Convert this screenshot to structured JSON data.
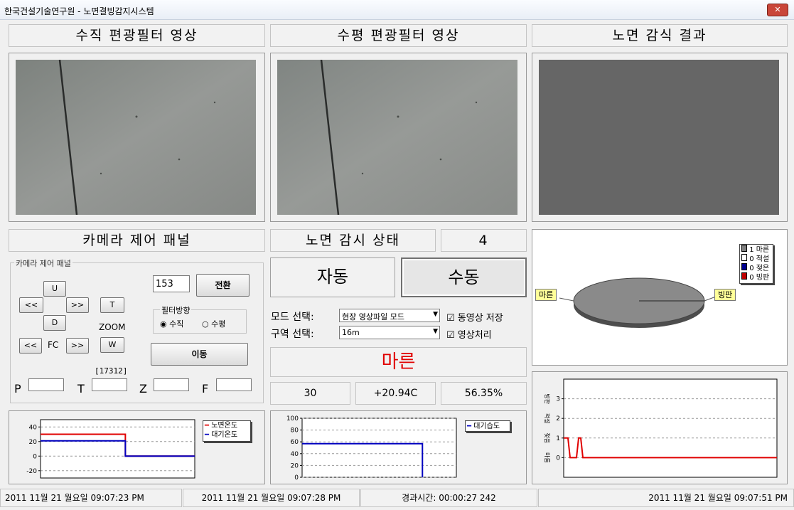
{
  "window": {
    "title": "한국건설기술연구원 - 노면결빙감지시스템",
    "close_label": "✕"
  },
  "panels": {
    "vertical_title": "수직 편광필터 영상",
    "horizontal_title": "수평 편광필터 영상",
    "result_title": "노면 감식 결과"
  },
  "camera": {
    "title": "카메라 제어 패널",
    "group_label": "카메라 제어 패널",
    "btn_up": "U",
    "btn_down": "D",
    "btn_left": "<<",
    "btn_right": ">>",
    "btn_t": "T",
    "btn_w": "W",
    "zoom_label": "ZOOM",
    "btn_fc_left": "<<",
    "fc_label": "FC",
    "btn_fc_right": ">>",
    "preset_value": "153",
    "switch_label": "전환",
    "filter_group": "필터방향",
    "radio_vertical": "수직",
    "radio_horizontal": "수평",
    "move_label": "이동",
    "counter": "[17312]",
    "p_label": "P",
    "t_label": "T",
    "z_label": "Z",
    "f_label": "F",
    "p_value": "",
    "t_value": "",
    "z_value": "",
    "f_value": ""
  },
  "monitor": {
    "title": "노면 감시 상태",
    "count": "4",
    "auto_label": "자동",
    "manual_label": "수동",
    "mode_label": "모드 선택:",
    "mode_value": "현장 영상파일 모드",
    "zone_label": "구역 선택:",
    "zone_value": "16m",
    "save_video_label": "동영상 저장",
    "image_proc_label": "영상처리",
    "state_text": "마른",
    "count2": "30",
    "temperature": "+20.94C",
    "humidity": "56.35%"
  },
  "pie": {
    "legend": [
      {
        "label": "1 마른",
        "color": "#808080"
      },
      {
        "label": "0 적설",
        "color": "#ffffff"
      },
      {
        "label": "0 젖은",
        "color": "#000090"
      },
      {
        "label": "0 빙판",
        "color": "#c00000"
      }
    ],
    "left_tag": "마른",
    "right_tag": "빙판",
    "slices": [
      {
        "label": "마른",
        "value": 1
      },
      {
        "label": "적설",
        "value": 0
      },
      {
        "label": "젖은",
        "value": 0
      },
      {
        "label": "빙판",
        "value": 0
      }
    ]
  },
  "charts": {
    "temp_legend_surface": "노면온도",
    "temp_legend_air": "대기온도",
    "hum_legend": "대기습도",
    "temp_ticks": [
      "40",
      "20",
      "0",
      "-20"
    ],
    "hum_ticks": [
      "100",
      "80",
      "60",
      "40",
      "20",
      "0"
    ],
    "state_ticks": [
      "3",
      "2",
      "1",
      "0"
    ],
    "state_labels": [
      "빙판",
      "적설",
      "젖음",
      "마름"
    ],
    "surface_color": "#e00000",
    "air_color": "#0000c0",
    "hum_color": "#0000c0",
    "state_color": "#e00000"
  },
  "chart_data": [
    {
      "type": "line",
      "ylim": [
        -30,
        50
      ],
      "series": [
        {
          "name": "노면온도",
          "x": [
            0,
            0.55,
            0.55,
            1.0
          ],
          "values": [
            30,
            30,
            0,
            0
          ]
        },
        {
          "name": "대기온도",
          "x": [
            0,
            0.55,
            0.55,
            1.0
          ],
          "values": [
            21,
            21,
            0,
            0
          ]
        }
      ]
    },
    {
      "type": "line",
      "ylim": [
        0,
        100
      ],
      "series": [
        {
          "name": "대기습도",
          "x": [
            0,
            0.78,
            0.78
          ],
          "values": [
            57,
            57,
            0
          ]
        }
      ]
    },
    {
      "type": "line",
      "ylim": [
        -1,
        4
      ],
      "series": [
        {
          "x": [
            0,
            0.02,
            0.03,
            0.06,
            0.07,
            0.08,
            0.09,
            1.0
          ],
          "values": [
            1,
            1,
            0,
            0,
            1,
            1,
            0,
            0
          ]
        }
      ]
    }
  ],
  "statusbar": {
    "start_time": "2011 11월 21 월요일 09:07:23 PM",
    "current_time": "2011 11월 21 월요일 09:07:28 PM",
    "elapsed": "경과시간: 00:00:27 242",
    "clock": "2011 11월 21 월요일 09:07:51 PM"
  }
}
